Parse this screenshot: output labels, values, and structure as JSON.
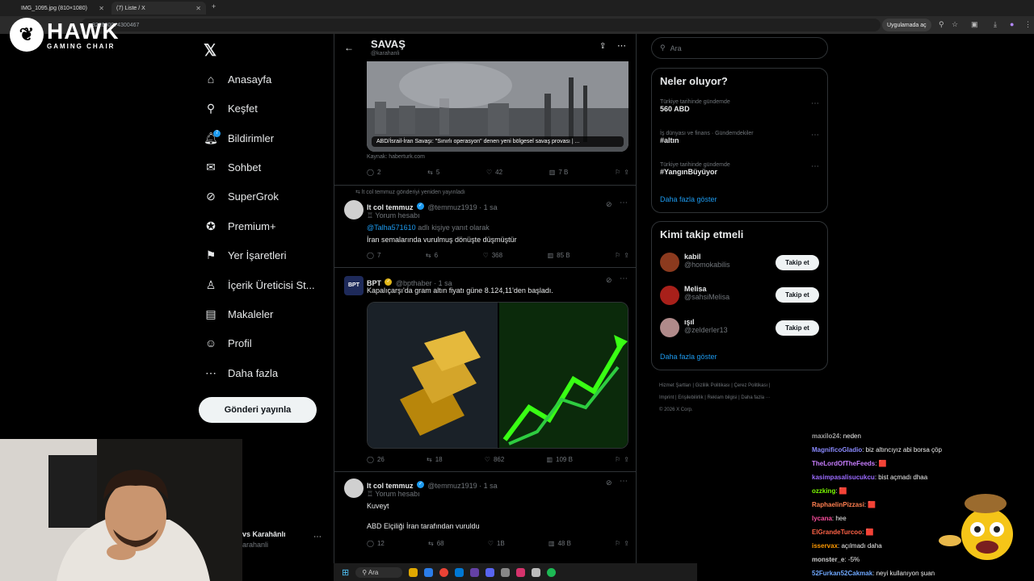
{
  "browser": {
    "tabs": [
      {
        "title": "IMG_1095.jpg (810×1080)"
      },
      {
        "title": "(7) Liste / X"
      }
    ],
    "url": "822690074300467",
    "app_pill": "Uygulamada aç"
  },
  "overlay_logo": {
    "title": "HAWK",
    "subtitle": "GAMING CHAIR"
  },
  "nav": {
    "x_logo": "𝕏",
    "items": [
      {
        "label": "Anasayfa",
        "icon": "⌂"
      },
      {
        "label": "Keşfet",
        "icon": "⚲"
      },
      {
        "label": "Bildirimler",
        "icon": "🔔︎",
        "badge": "7"
      },
      {
        "label": "Sohbet",
        "icon": "✉"
      },
      {
        "label": "SuperGrok",
        "icon": "⊘"
      },
      {
        "label": "Premium+",
        "icon": "✪"
      },
      {
        "label": "Yer İşaretleri",
        "icon": "⚑"
      },
      {
        "label": "İçerik Üreticisi St...",
        "icon": "♙"
      },
      {
        "label": "Makaleler",
        "icon": "▤"
      },
      {
        "label": "Profil",
        "icon": "☺"
      },
      {
        "label": "Daha fazla",
        "icon": "⋯"
      }
    ],
    "post_button": "Gönderi yayınla",
    "profile_name": "vs Karahânlı",
    "profile_handle": "arahanli"
  },
  "timeline": {
    "title": "SAVAŞ",
    "subtitle": "@karahanli",
    "tweet0": {
      "card_caption": "ABD/İsrail-İran Savaşı: \"Sınırlı operasyon\" denen yeni bölgesel savaş provası | ...",
      "source": "Kaynak: haberturk.com",
      "replies": "2",
      "reposts": "5",
      "likes": "42",
      "views": "7 B"
    },
    "tweet1": {
      "repost_note": "lt col temmuz gönderiyi yeniden yayınladı",
      "name": "lt col temmuz",
      "handle": "@temmuz1919 · 1 sa",
      "label": "Yorum hesabı",
      "reply_to_user": "@Talha571610",
      "reply_to_suffix": " adlı kişiye yanıt olarak",
      "text": "İran semalarında vurulmuş dönüşte düşmüştür",
      "replies": "7",
      "reposts": "6",
      "likes": "368",
      "views": "85 B"
    },
    "tweet2": {
      "name": "BPT",
      "handle": "@bpthaber · 1 sa",
      "text": "Kapalıçarşı'da gram altın fiyatı güne 8.124,11'den başladı.",
      "replies": "26",
      "reposts": "18",
      "likes": "862",
      "views": "109 B"
    },
    "tweet3": {
      "name": "lt col temmuz",
      "handle": "@temmuz1919 · 1 sa",
      "label": "Yorum hesabı",
      "text1": "Kuveyt",
      "text2": "ABD Elçiliği İran tarafından vuruldu",
      "replies": "12",
      "reposts": "68",
      "likes": "1B",
      "views": "48 B"
    }
  },
  "sidebar": {
    "search_placeholder": "Ara",
    "trends": {
      "title": "Neler oluyor?",
      "items": [
        {
          "meta": "Türkiye tarihinde gündemde",
          "name": "560 ABD"
        },
        {
          "meta": "İş dünyası ve finans · Gündemdekiler",
          "name": "#altın"
        },
        {
          "meta": "Türkiye tarihinde gündemde",
          "name": "#YangınBüyüyor"
        }
      ],
      "more": "Daha fazla göster"
    },
    "follow": {
      "title": "Kimi takip etmeli",
      "button": "Takip et",
      "items": [
        {
          "name": "kabil",
          "handle": "@homokabilis"
        },
        {
          "name": "Melisa",
          "handle": "@sahsiMelisa"
        },
        {
          "name": "ışıl",
          "handle": "@zelderler13"
        }
      ],
      "more": "Daha fazla göster"
    },
    "footer": {
      "line1": "Hizmet Şartları  |  Gizlilik Politikası  |  Çerez Politikası  |",
      "line2": "Imprint  |  Erişilebilirlik  |  Reklam bilgisi  |  Daha fazla ···",
      "line3": "© 2026 X Corp."
    }
  },
  "chat": [
    {
      "user": "maxilo24",
      "msg": ": neden",
      "color": "#a0a0a0"
    },
    {
      "user": "MagnificoGladio",
      "msg": ": biz altıncıyız abi borsa çöp",
      "color": "#8a8aff"
    },
    {
      "user": "TheLordOfTheFeeds",
      "msg": ": 🟥",
      "color": "#c77dff"
    },
    {
      "user": "kasimpasalisucukcu",
      "msg": ": bist açmadı dhaa",
      "color": "#9b6bff"
    },
    {
      "user": "ozzking",
      "msg": ": 🟥",
      "color": "#7cfc00"
    },
    {
      "user": "RaphaelinPizzasi",
      "msg": ": 🟥",
      "color": "#ff7f50"
    },
    {
      "user": "lycana",
      "msg": ": hee",
      "color": "#ff4fa0"
    },
    {
      "user": "ElGrandeTurcoo",
      "msg": ": 🟥",
      "color": "#ff6347"
    },
    {
      "user": "isservax",
      "msg": ": açılmadı daha",
      "color": "#ff9900"
    },
    {
      "user": "monster_e",
      "msg": ": -5%",
      "color": "#cfcfcf"
    },
    {
      "user": "52Furkan52Cakmak",
      "msg": ": neyi kullanıyon şuan",
      "color": "#6fa8ff"
    }
  ],
  "taskbar": {
    "search": "Ara"
  }
}
